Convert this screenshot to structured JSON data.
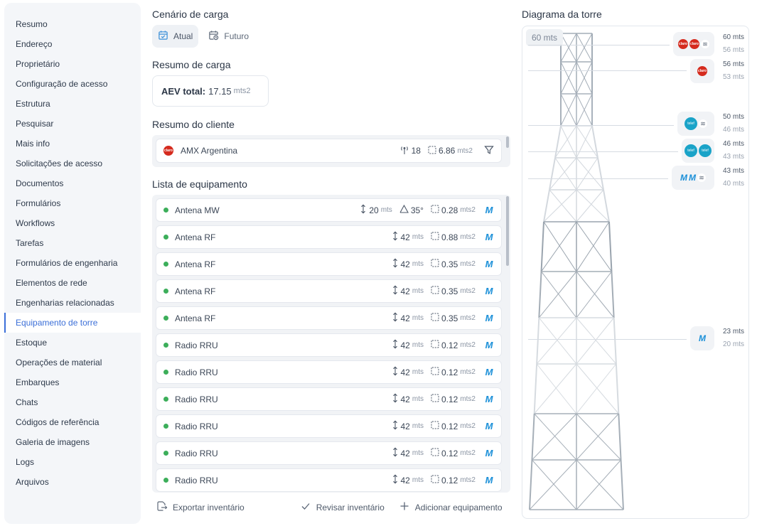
{
  "sidebar": {
    "items": [
      {
        "label": "Resumo"
      },
      {
        "label": "Endereço"
      },
      {
        "label": "Proprietário"
      },
      {
        "label": "Configuração de acesso"
      },
      {
        "label": "Estrutura"
      },
      {
        "label": "Pesquisar"
      },
      {
        "label": "Mais info"
      },
      {
        "label": "Solicitações de acesso"
      },
      {
        "label": "Documentos"
      },
      {
        "label": "Formulários"
      },
      {
        "label": "Workflows"
      },
      {
        "label": "Tarefas"
      },
      {
        "label": "Formulários de engenharia"
      },
      {
        "label": "Elementos de rede"
      },
      {
        "label": "Engenharias relacionadas"
      },
      {
        "label": "Equipamento de torre",
        "active": true
      },
      {
        "label": "Estoque"
      },
      {
        "label": "Operações de material"
      },
      {
        "label": "Embarques"
      },
      {
        "label": "Chats"
      },
      {
        "label": "Códigos de referência"
      },
      {
        "label": "Galeria de imagens"
      },
      {
        "label": "Logs"
      },
      {
        "label": "Arquivos"
      }
    ]
  },
  "scenario": {
    "title": "Cenário de carga",
    "options": [
      {
        "label": "Atual",
        "icon": "calendar-check-icon",
        "active": true
      },
      {
        "label": "Futuro",
        "icon": "calendar-clock-icon",
        "active": false
      }
    ]
  },
  "load_summary": {
    "title": "Resumo de carga",
    "aev_label": "AEV total:",
    "aev_value": "17.15",
    "aev_unit": "mts2"
  },
  "client_summary": {
    "title": "Resumo do cliente",
    "client": {
      "name": "AMX Argentina",
      "logo": "claro-logo",
      "antennas": "18",
      "area": "6.86",
      "area_unit": "mts2"
    },
    "filter_icon": "filter-icon"
  },
  "equipment": {
    "title": "Lista de equipamento",
    "height_unit": "mts",
    "area_unit": "mts2",
    "rows": [
      {
        "name": "Antena MW",
        "height": "20",
        "tilt": "35°",
        "area": "0.28",
        "owner_logo": "M"
      },
      {
        "name": "Antena RF",
        "height": "42",
        "area": "0.88",
        "owner_logo": "M"
      },
      {
        "name": "Antena RF",
        "height": "42",
        "area": "0.35",
        "owner_logo": "M"
      },
      {
        "name": "Antena RF",
        "height": "42",
        "area": "0.35",
        "owner_logo": "M"
      },
      {
        "name": "Antena RF",
        "height": "42",
        "area": "0.35",
        "owner_logo": "M"
      },
      {
        "name": "Radio RRU",
        "height": "42",
        "area": "0.12",
        "owner_logo": "M"
      },
      {
        "name": "Radio RRU",
        "height": "42",
        "area": "0.12",
        "owner_logo": "M"
      },
      {
        "name": "Radio RRU",
        "height": "42",
        "area": "0.12",
        "owner_logo": "M"
      },
      {
        "name": "Radio RRU",
        "height": "42",
        "area": "0.12",
        "owner_logo": "M"
      },
      {
        "name": "Radio RRU",
        "height": "42",
        "area": "0.12",
        "owner_logo": "M"
      },
      {
        "name": "Radio RRU",
        "height": "42",
        "area": "0.12",
        "owner_logo": "M"
      }
    ]
  },
  "actions": {
    "export": "Exportar inventário",
    "review": "Revisar inventário",
    "add": "Adicionar equipamento"
  },
  "tower": {
    "title": "Diagrama da torre",
    "height_label": "60 mts",
    "levels": [
      {
        "top": "60 mts",
        "bottom": "56 mts",
        "logos": [
          "claro",
          "claro",
          "layers"
        ]
      },
      {
        "top": "56 mts",
        "bottom": "53 mts",
        "logos": [
          "claro"
        ]
      },
      {
        "top": "50 mts",
        "bottom": "46 mts",
        "logos": [
          "telefonica",
          "layers"
        ]
      },
      {
        "top": "46 mts",
        "bottom": "43 mts",
        "logos": [
          "telefonica",
          "telefonica"
        ]
      },
      {
        "top": "43 mts",
        "bottom": "40 mts",
        "logos": [
          "M",
          "M",
          "layers"
        ]
      },
      {
        "top": "23 mts",
        "bottom": "20 mts",
        "logos": [
          "M"
        ]
      }
    ]
  }
}
